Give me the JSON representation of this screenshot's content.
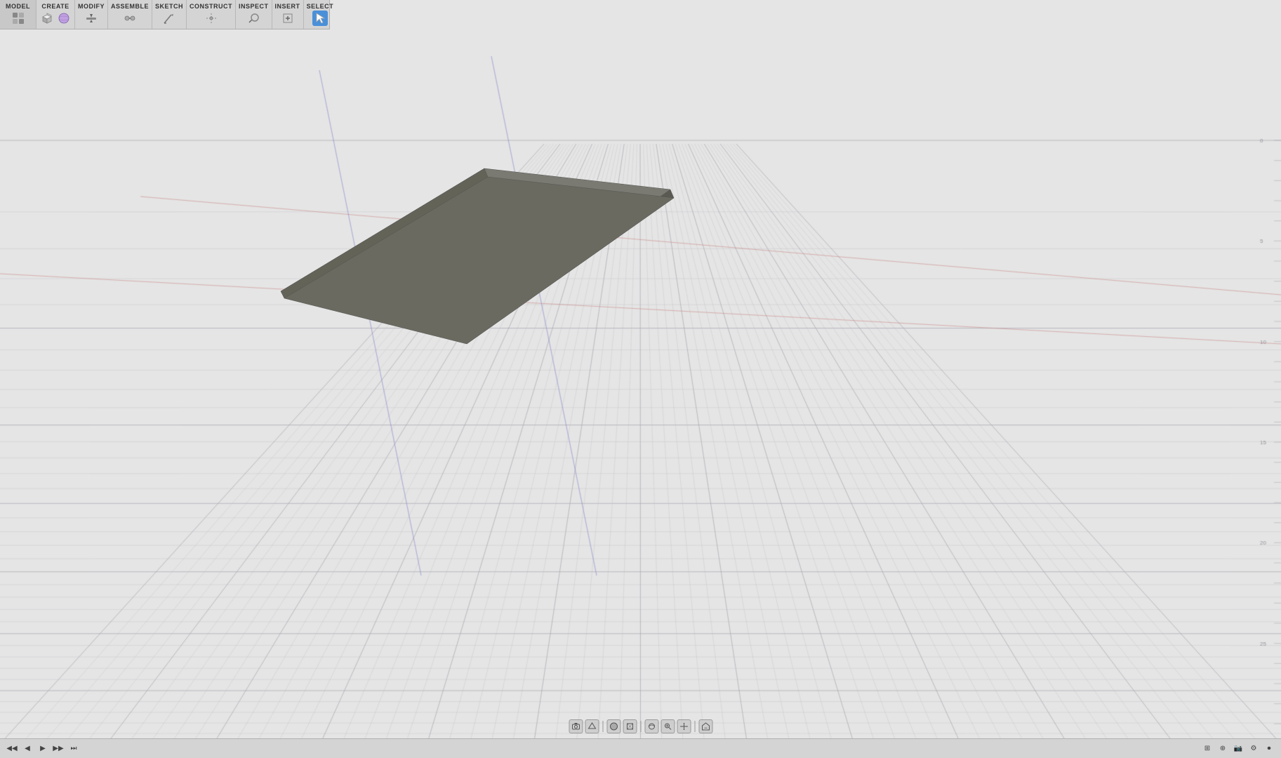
{
  "toolbar": {
    "model_label": "MODEL",
    "sections": [
      {
        "id": "model",
        "label": "MODEL",
        "icons": [
          "grid-icon"
        ]
      },
      {
        "id": "create",
        "label": "CREATE",
        "icons": [
          "box-icon",
          "sphere-icon"
        ]
      },
      {
        "id": "modify",
        "label": "MODIFY",
        "icons": [
          "modify-icon"
        ]
      },
      {
        "id": "assemble",
        "label": "ASSEMBLE",
        "icons": [
          "assemble-icon"
        ]
      },
      {
        "id": "sketch",
        "label": "SKETCH",
        "icons": [
          "sketch-icon"
        ]
      },
      {
        "id": "construct",
        "label": "CONSTRUCT",
        "icons": [
          "construct-icon"
        ]
      },
      {
        "id": "inspect",
        "label": "INSPECT",
        "icons": [
          "inspect-icon"
        ]
      },
      {
        "id": "insert",
        "label": "INSERT",
        "icons": [
          "insert-icon"
        ]
      },
      {
        "id": "select",
        "label": "SELECT",
        "icons": [
          "select-icon"
        ]
      }
    ]
  },
  "statusbar": {
    "buttons": [
      "prev-icon",
      "next-icon",
      "play-icon",
      "end-icon",
      "camera-icon",
      "settings-icon",
      "record-icon"
    ]
  },
  "viewport_controls": {
    "buttons": [
      "camera-btn",
      "perspective-btn",
      "sep",
      "render-btn",
      "wireframe-btn",
      "sep2",
      "orbit-btn",
      "zoom-btn",
      "pan-btn",
      "sep3",
      "home-btn"
    ]
  },
  "plate": {
    "color_top": "#7a7a72",
    "color_side": "#5a5a52",
    "color_right": "#636358"
  }
}
